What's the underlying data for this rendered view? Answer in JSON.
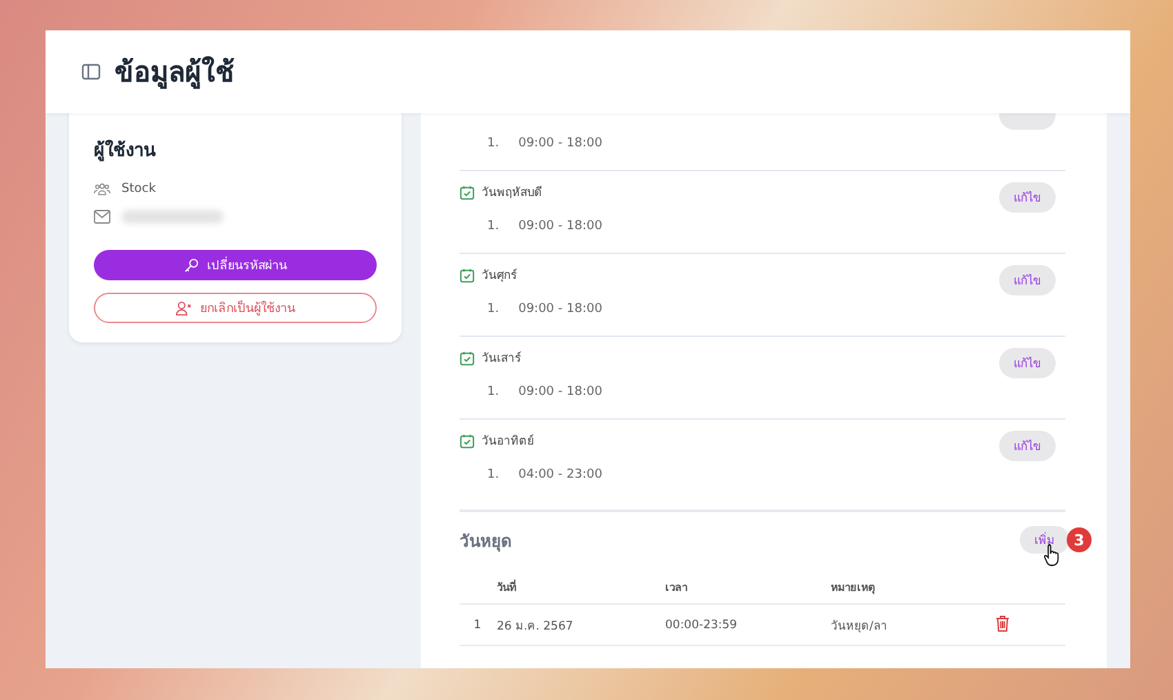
{
  "header": {
    "title": "ข้อมูลผู้ใช้"
  },
  "user_card": {
    "heading": "ผู้ใช้งาน",
    "group": "Stock",
    "buttons": [
      {
        "label": "เปลี่ยนรหัสผ่าน",
        "kind": "primary"
      },
      {
        "label": "ยกเลิกเป็นผู้ใช้งาน",
        "kind": "outline"
      }
    ]
  },
  "schedule": [
    {
      "times": [
        {
          "index": "1.",
          "range": "09:00 - 18:00"
        }
      ]
    },
    {
      "day": "วันพฤหัสบดี",
      "times": [
        {
          "index": "1.",
          "range": "09:00 - 18:00"
        }
      ],
      "button": "แก้ไข"
    },
    {
      "day": "วันศุกร์",
      "times": [
        {
          "index": "1.",
          "range": "09:00 - 18:00"
        }
      ],
      "button": "แก้ไข"
    },
    {
      "day": "วันเสาร์",
      "times": [
        {
          "index": "1.",
          "range": "09:00 - 18:00"
        }
      ],
      "button": "แก้ไข"
    },
    {
      "day": "วันอาทิตย์",
      "times": [
        {
          "index": "1.",
          "range": "04:00 - 23:00"
        }
      ],
      "button": "แก้ไข"
    }
  ],
  "holidays": {
    "title": "วันหยุด",
    "add_button": "เพิ่ม",
    "step_badge": "3",
    "columns": [
      "วันที่",
      "เวลา",
      "หมายเหตุ"
    ],
    "rows": [
      {
        "index": "1",
        "date": "26 ม.ค. 2567",
        "time": "00:00-23:59",
        "note": "วันหยุด/ลา"
      }
    ]
  }
}
